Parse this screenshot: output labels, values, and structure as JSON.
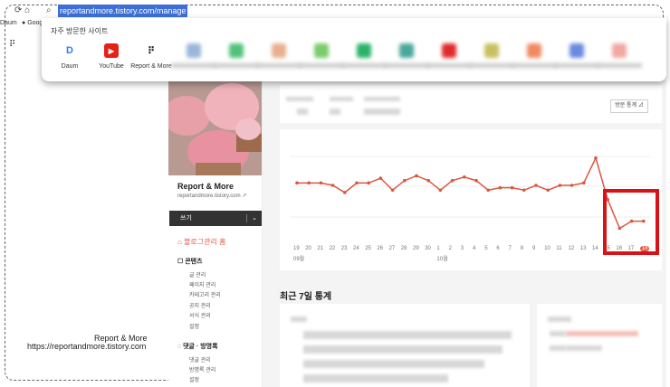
{
  "browser": {
    "url": "reportandmore.tistory.com/manage",
    "bookmarks": [
      "Daum",
      "Goog"
    ]
  },
  "frequent_sites": {
    "title": "자주 방문한 사이트",
    "sites": [
      {
        "label": "Daum",
        "color": "#2d7cf6"
      },
      {
        "label": "YouTube",
        "color": "#e62117"
      },
      {
        "label": "Report & More",
        "color": "#222222"
      }
    ]
  },
  "sidebar": {
    "blog_name": "Report & More",
    "blog_url": "reportandmore.tistory.com",
    "write_label": "쓰기",
    "home_label": "블로그관리 홈",
    "content_section": "콘텐츠",
    "content_items": [
      "글 관리",
      "페이지 관리",
      "카테고리 관리",
      "공지 관리",
      "서식 관리",
      "설정"
    ],
    "comment_section": "댓글 · 방명록",
    "comment_items": [
      "댓글 관리",
      "방명록 관리",
      "설정"
    ]
  },
  "profile": {
    "name": "Report & More",
    "url": "https://reportandmore.tistory.com"
  },
  "stats": {
    "visit_button": "방문 통계",
    "weekly_title": "최근 7일 통계"
  },
  "chart_data": {
    "type": "line",
    "x": [
      "19",
      "20",
      "21",
      "22",
      "23",
      "24",
      "25",
      "26",
      "27",
      "28",
      "29",
      "30",
      "1",
      "2",
      "3",
      "4",
      "5",
      "6",
      "7",
      "8",
      "9",
      "10",
      "11",
      "12",
      "13",
      "14",
      "15",
      "16",
      "17",
      "18"
    ],
    "month_labels": [
      "09월",
      "10월"
    ],
    "series": [
      {
        "values": [
          52,
          52,
          52,
          50,
          44,
          52,
          52,
          56,
          46,
          54,
          58,
          54,
          46,
          54,
          57,
          54,
          46,
          48,
          48,
          46,
          50,
          46,
          50,
          50,
          52,
          73,
          38,
          14,
          20,
          20
        ]
      }
    ],
    "accent_color": "#d9583f"
  }
}
